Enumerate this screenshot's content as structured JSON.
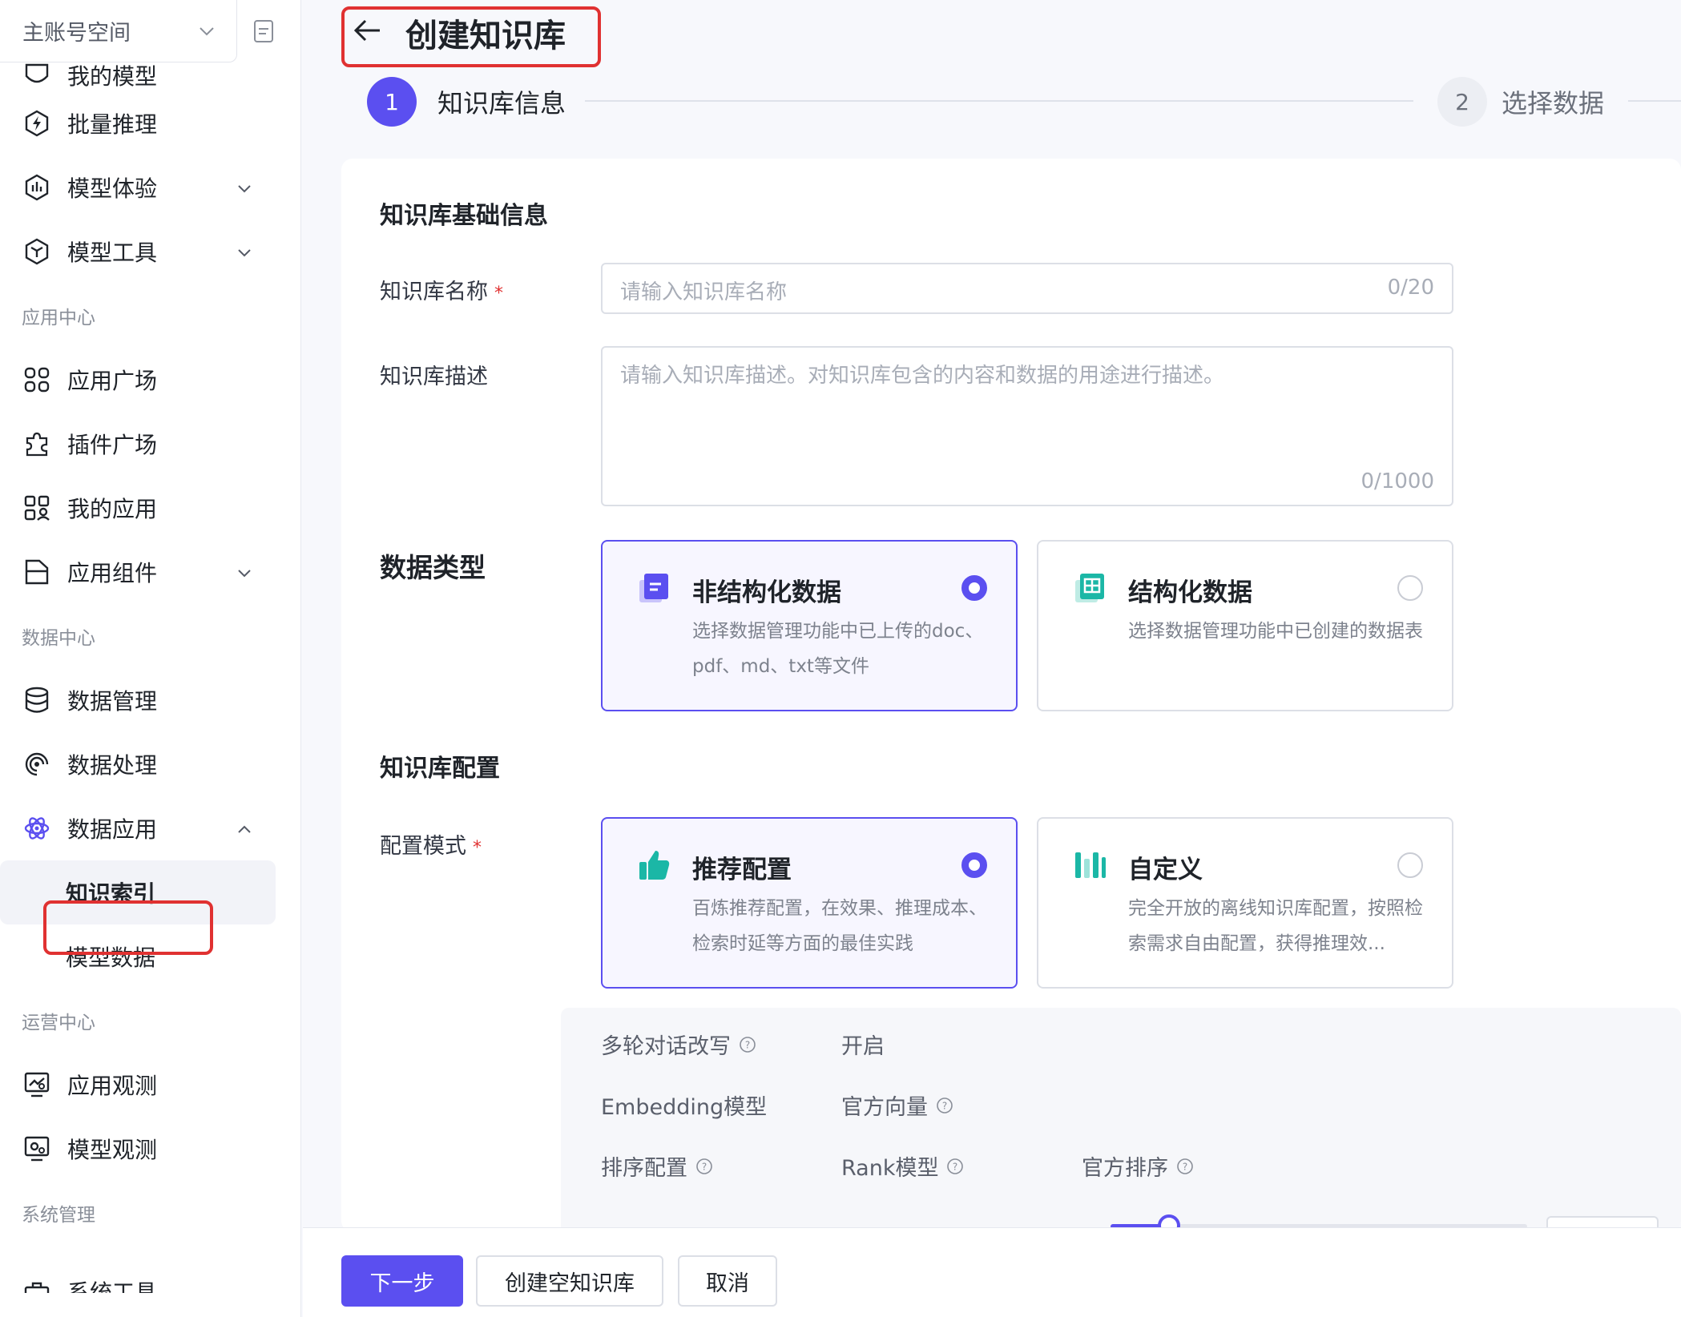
{
  "sidebar": {
    "workspace": "主账号空间",
    "items": [
      {
        "label": "我的模型",
        "icon": "model-shield-icon"
      },
      {
        "label": "批量推理",
        "icon": "bolt-hexagon-icon"
      },
      {
        "label": "模型体验",
        "icon": "chart-hexagon-icon"
      },
      {
        "label": "模型工具",
        "icon": "cube-hexagon-icon"
      },
      {
        "group": "应用中心"
      },
      {
        "label": "应用广场",
        "icon": "grid-icon"
      },
      {
        "label": "插件广场",
        "icon": "puzzle-icon"
      },
      {
        "label": "我的应用",
        "icon": "user-apps-icon"
      },
      {
        "label": "应用组件",
        "icon": "folder-icon"
      },
      {
        "group": "数据中心"
      },
      {
        "label": "数据管理",
        "icon": "database-icon"
      },
      {
        "label": "数据处理",
        "icon": "spiral-icon"
      },
      {
        "label": "数据应用",
        "icon": "atom-icon"
      },
      {
        "label": "知识索引"
      },
      {
        "label": "模型数据"
      },
      {
        "group": "运营中心"
      },
      {
        "label": "应用观测",
        "icon": "monitor-chart-icon"
      },
      {
        "label": "模型观测",
        "icon": "monitor-gear-icon"
      },
      {
        "group": "系统管理"
      },
      {
        "label": "系统工具",
        "icon": "toolbox-icon"
      }
    ]
  },
  "page": {
    "title": "创建知识库",
    "steps": [
      {
        "index": "1",
        "label": "知识库信息",
        "active": true
      },
      {
        "index": "2",
        "label": "选择数据",
        "active": false
      }
    ]
  },
  "form": {
    "basic_title": "知识库基础信息",
    "name_label": "知识库名称",
    "required_mark": "*",
    "name_placeholder": "请输入知识库名称",
    "name_count": "0/20",
    "desc_label": "知识库描述",
    "desc_placeholder": "请输入知识库描述。对知识库包含的内容和数据的用途进行描述。",
    "desc_count": "0/1000",
    "data_type_title": "数据类型",
    "data_types": [
      {
        "title": "非结构化数据",
        "desc": "选择数据管理功能中已上传的doc、pdf、md、txt等文件",
        "selected": true
      },
      {
        "title": "结构化数据",
        "desc": "选择数据管理功能中已创建的数据表",
        "selected": false
      }
    ],
    "config_title": "知识库配置",
    "mode_label": "配置模式",
    "modes": [
      {
        "title": "推荐配置",
        "desc": "百炼推荐配置，在效果、推理成本、检索时延等方面的最佳实践",
        "selected": true
      },
      {
        "title": "自定义",
        "desc": "完全开放的离线知识库配置，按照检索需求自由配置，获得推理效...",
        "selected": false
      }
    ],
    "details": {
      "rewrite_label": "多轮对话改写",
      "rewrite_value": "开启",
      "embedding_label": "Embedding模型",
      "embedding_value": "官方向量",
      "rank_label": "排序配置",
      "rank_model_label": "Rank模型",
      "rank_model_value": "官方排序"
    },
    "slider_value": 0.14
  },
  "footer": {
    "next": "下一步",
    "create_empty": "创建空知识库",
    "cancel": "取消"
  },
  "colors": {
    "accent": "#5b4ff0",
    "highlight_box": "#e03131",
    "teal": "#1bb7a6"
  }
}
